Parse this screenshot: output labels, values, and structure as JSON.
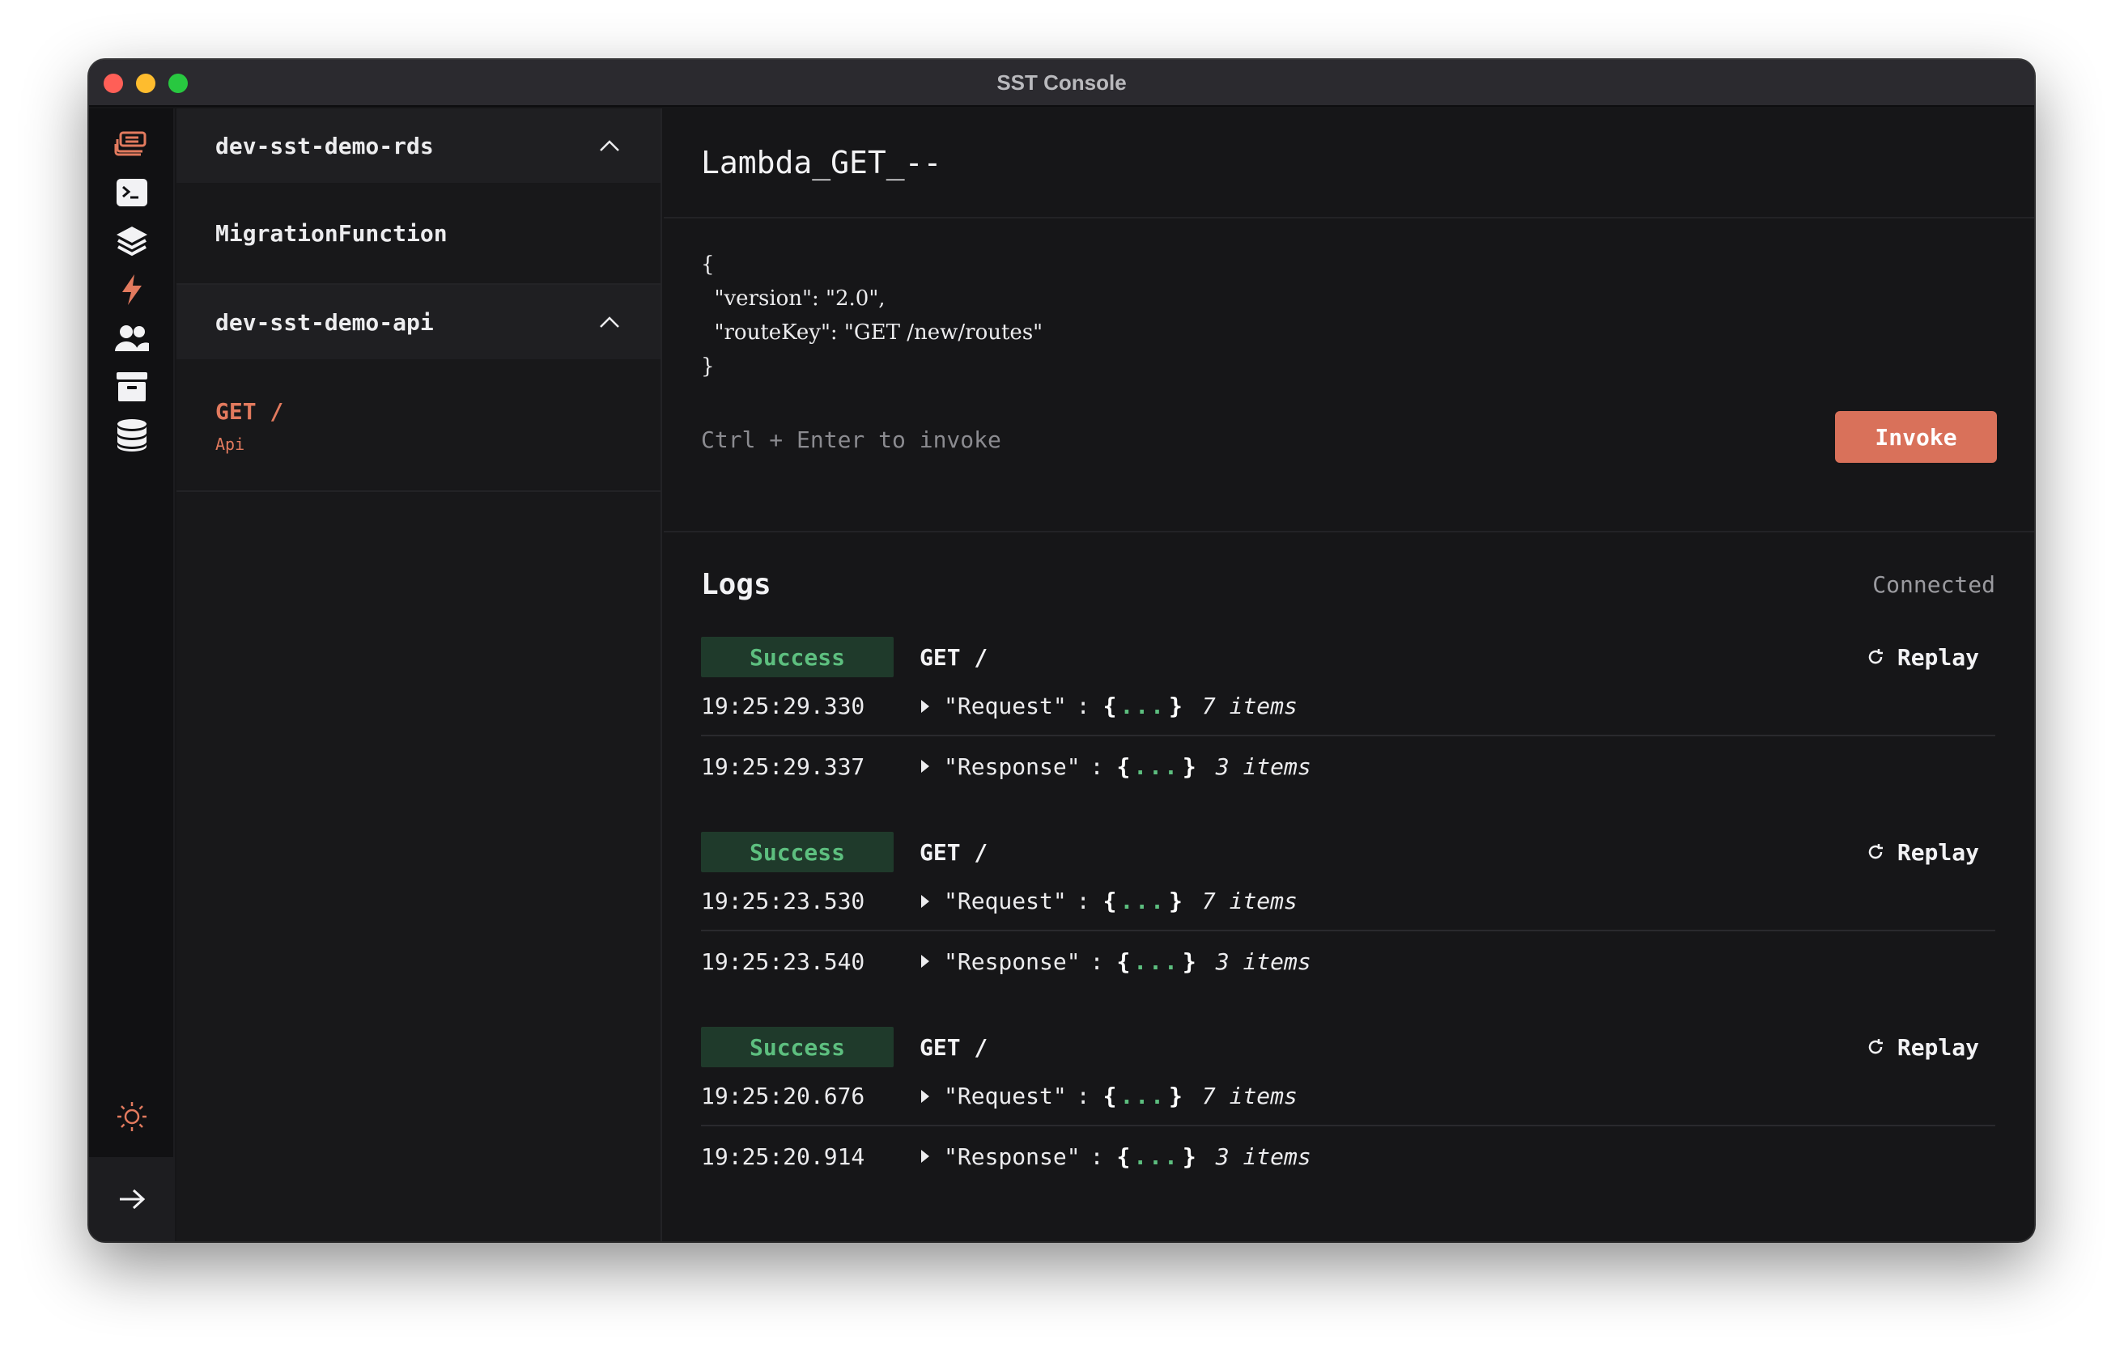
{
  "window": {
    "title": "SST Console"
  },
  "rail": {
    "icons": [
      "stacks-icon",
      "terminal-icon",
      "layers-icon",
      "lightning-icon",
      "users-icon",
      "archive-icon",
      "database-icon",
      "sun-icon",
      "arrow-right-icon"
    ],
    "active_color": "#e27a5e"
  },
  "panel": {
    "groups": [
      {
        "name": "dev-sst-demo-rds",
        "items": [
          {
            "label": "MigrationFunction"
          }
        ]
      },
      {
        "name": "dev-sst-demo-api",
        "items": [
          {
            "label": "GET /",
            "sub": "Api"
          }
        ]
      }
    ]
  },
  "main": {
    "title": "Lambda_GET_--",
    "payload": "{\n  \"version\": \"2.0\",\n  \"routeKey\": \"GET /new/routes\"\n}",
    "hint": "Ctrl + Enter to invoke",
    "invoke_label": "Invoke"
  },
  "logs": {
    "title": "Logs",
    "status": "Connected",
    "replay_label": "Replay",
    "entries": [
      {
        "status": "Success",
        "route": "GET /",
        "request": {
          "time": "19:25:29.330",
          "key": "\"Request\"",
          "sep": ":",
          "open": "{",
          "dots": "...",
          "close": "}",
          "count": "7 items"
        },
        "response": {
          "time": "19:25:29.337",
          "key": "\"Response\"",
          "sep": ":",
          "open": "{",
          "dots": "...",
          "close": "}",
          "count": "3 items"
        }
      },
      {
        "status": "Success",
        "route": "GET /",
        "request": {
          "time": "19:25:23.530",
          "key": "\"Request\"",
          "sep": ":",
          "open": "{",
          "dots": "...",
          "close": "}",
          "count": "7 items"
        },
        "response": {
          "time": "19:25:23.540",
          "key": "\"Response\"",
          "sep": ":",
          "open": "{",
          "dots": "...",
          "close": "}",
          "count": "3 items"
        }
      },
      {
        "status": "Success",
        "route": "GET /",
        "request": {
          "time": "19:25:20.676",
          "key": "\"Request\"",
          "sep": ":",
          "open": "{",
          "dots": "...",
          "close": "}",
          "count": "7 items"
        },
        "response": {
          "time": "19:25:20.914",
          "key": "\"Response\"",
          "sep": ":",
          "open": "{",
          "dots": "...",
          "close": "}",
          "count": "3 items"
        }
      }
    ]
  }
}
